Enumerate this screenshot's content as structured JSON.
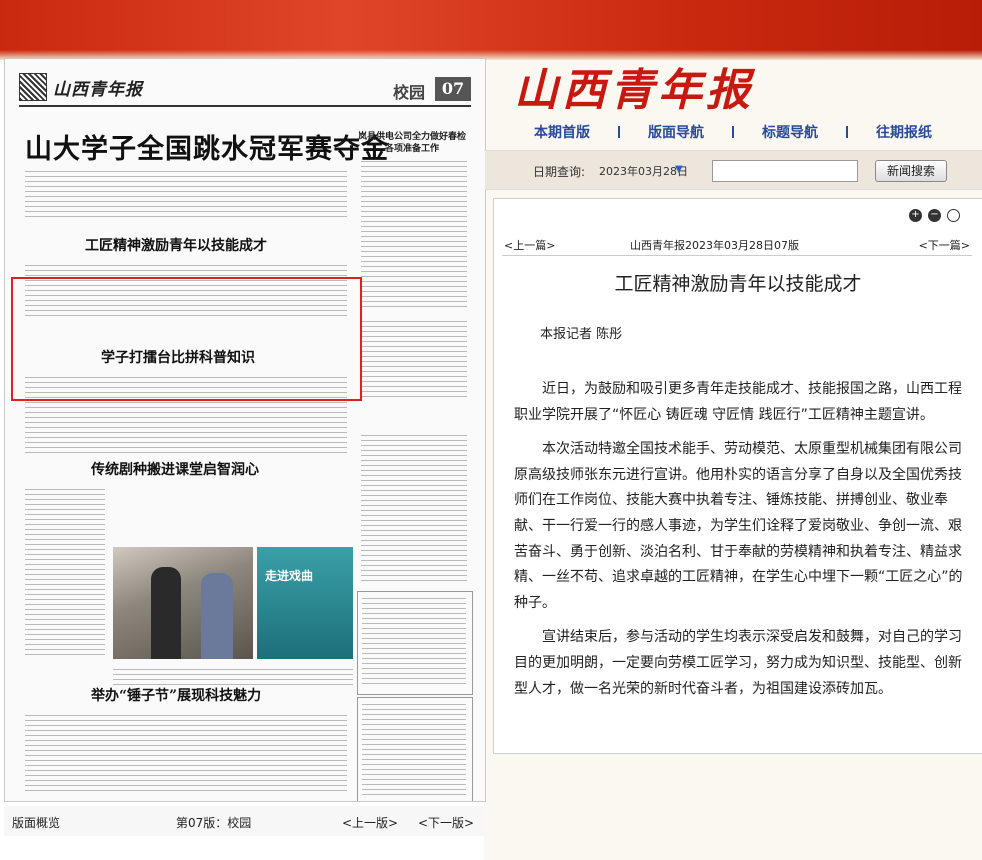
{
  "colors": {
    "brand_red": "#c8180f",
    "nav_blue": "#2a4a9a",
    "highlight": "#e02020"
  },
  "site": {
    "name": "山西青年报"
  },
  "nav": {
    "items": [
      {
        "label": "本期首版"
      },
      {
        "label": "版面导航"
      },
      {
        "label": "标题导航"
      },
      {
        "label": "往期报纸"
      }
    ]
  },
  "date_query": {
    "label": "日期查询:",
    "value": "2023年03月28日",
    "arrow_icon": "triangle-down-icon",
    "search_value": "",
    "search_button": "新闻搜索"
  },
  "paper_page": {
    "logo": "山西青年报",
    "section": "校园",
    "page_number": "07",
    "headlines": {
      "main": "山大学子全国跳水冠军赛夺金",
      "side": "岚县供电公司全力做好春检各项准备工作",
      "highlighted": "工匠精神激励青年以技能成才",
      "h3": "学子打擂台比拼科普知识",
      "h4": "传统剧种搬进课堂启智润心",
      "h5": "举办“锤子节”展现科技魅力"
    },
    "photo_text": "走进戏曲"
  },
  "article": {
    "prev_link": "<上一篇>",
    "next_link": "<下一篇>",
    "source_line": "山西青年报2023年03月28日07版",
    "title": "工匠精神激励青年以技能成才",
    "author": "本报记者 陈彤",
    "paragraphs": [
      "近日，为鼓励和吸引更多青年走技能成才、技能报国之路，山西工程职业学院开展了“怀匠心 铸匠魂 守匠情 践匠行”工匠精神主题宣讲。",
      "本次活动特邀全国技术能手、劳动模范、太原重型机械集团有限公司原高级技师张东元进行宣讲。他用朴实的语言分享了自身以及全国优秀技师们在工作岗位、技能大赛中执着专注、锤炼技能、拼搏创业、敬业奉献、干一行爱一行的感人事迹，为学生们诠释了爱岗敬业、争创一流、艰苦奋斗、勇于创新、淡泊名利、甘于奉献的劳模精神和执着专注、精益求精、一丝不苟、追求卓越的工匠精神，在学生心中埋下一颗“工匠之心”的种子。",
      "宣讲结束后，参与活动的学生均表示深受启发和鼓舞，对自己的学习目的更加明朗，一定要向劳模工匠学习，努力成为知识型、技能型、创新型人才，做一名光荣的新时代奋斗者，为祖国建设添砖加瓦。"
    ]
  },
  "bottom_bar": {
    "overview": "版面概览",
    "page_label": "第07版：校园",
    "prev": "<上一版>",
    "next": "<下一版>"
  }
}
